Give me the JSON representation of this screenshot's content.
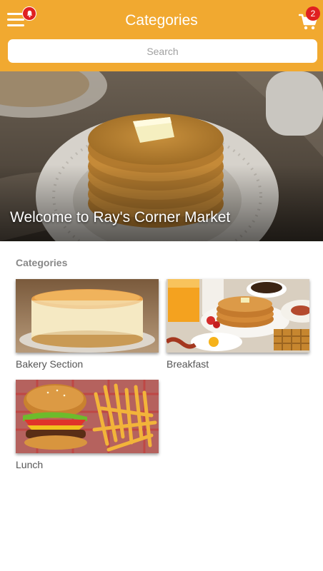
{
  "header": {
    "title": "Categories",
    "menu_icon": "hamburger-menu-icon",
    "notification_icon": "bell-icon",
    "cart_icon": "shopping-cart-icon",
    "cart_count": "2",
    "search_placeholder": "Search",
    "accent_color": "#f1a930"
  },
  "hero": {
    "title": "Welcome to Ray's Corner Market"
  },
  "categories": {
    "heading": "Categories",
    "items": [
      {
        "label": "Bakery Section"
      },
      {
        "label": "Breakfast"
      },
      {
        "label": "Lunch"
      }
    ]
  }
}
